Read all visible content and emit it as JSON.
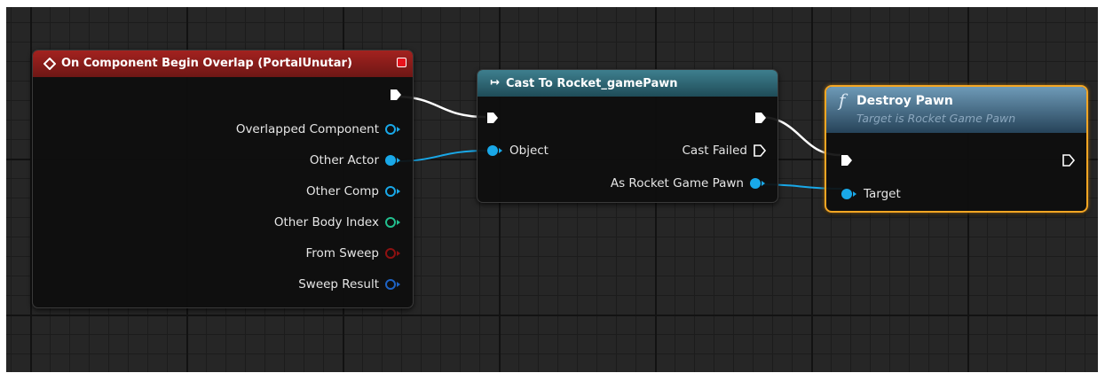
{
  "colors": {
    "exec": "#ffffff",
    "object": "#19a8e8",
    "struct": "#1e63c4",
    "integer": "#22c08f",
    "boolean": "#8e1111",
    "event_header": "#a3221f",
    "cast_header": "#2f6b7a",
    "function_header": "#4f7d9c",
    "selection": "#f5a623"
  },
  "event_node": {
    "icon": "diamond-event-icon",
    "title": "On Component Begin Overlap (PortalUnutar)",
    "pins": [
      {
        "label": "",
        "type": "exec"
      },
      {
        "label": "Overlapped Component",
        "type": "object"
      },
      {
        "label": "Other Actor",
        "type": "object"
      },
      {
        "label": "Other Comp",
        "type": "object"
      },
      {
        "label": "Other Body Index",
        "type": "integer"
      },
      {
        "label": "From Sweep",
        "type": "boolean"
      },
      {
        "label": "Sweep Result",
        "type": "struct"
      }
    ]
  },
  "cast_node": {
    "icon": "cast-arrow-icon",
    "icon_glyph": "↦",
    "title": "Cast To Rocket_gamePawn",
    "inputs": [
      {
        "label": "",
        "type": "exec"
      },
      {
        "label": "Object",
        "type": "object"
      }
    ],
    "outputs": [
      {
        "label": "",
        "type": "exec"
      },
      {
        "label": "Cast Failed",
        "type": "exec"
      },
      {
        "label": "As Rocket Game Pawn",
        "type": "object"
      }
    ]
  },
  "function_node": {
    "icon": "function-icon",
    "icon_glyph": "f",
    "title": "Destroy Pawn",
    "subtitle": "Target is Rocket Game Pawn",
    "inputs": [
      {
        "label": "",
        "type": "exec"
      },
      {
        "label": "Target",
        "type": "object"
      }
    ],
    "outputs": [
      {
        "label": "",
        "type": "exec"
      }
    ]
  }
}
